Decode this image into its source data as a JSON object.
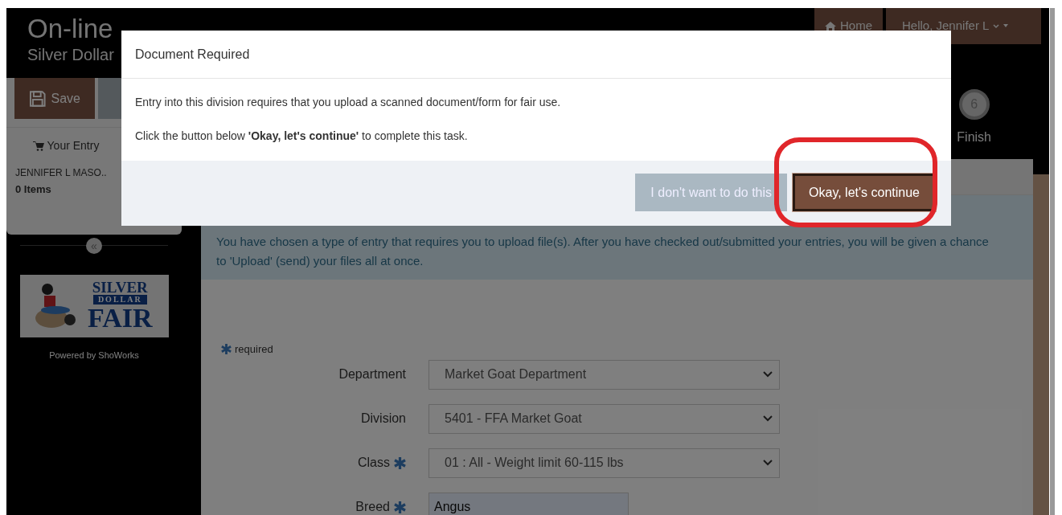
{
  "header": {
    "title": "On-line",
    "subtitle": "Silver Dollar"
  },
  "nav": [
    {
      "kind": "link",
      "label": "Home"
    },
    {
      "kind": "dropdown",
      "label": "Hello, Jennifer L"
    }
  ],
  "sidebar": {
    "save_button": "Save",
    "cart_label": "Your Entry",
    "entrant": "JENNIFER L MASO..",
    "items": "0 Items",
    "collapse": "«",
    "logo": [
      "SILVER",
      "DOLLAR",
      "FAIR"
    ],
    "powered_by": "Powered by ShoWorks"
  },
  "steps": [
    {
      "number": "6",
      "label": "Finish"
    }
  ],
  "alert": {
    "text": "You have chosen a type of entry that requires you to upload file(s). After you have checked out/submitted your entries, you will be given a chance to 'Upload' (send) your files all at once."
  },
  "form": {
    "required_note": "required",
    "fields": [
      {
        "label": "Department",
        "required": false,
        "kind": "select",
        "value": "Market Goat Department"
      },
      {
        "label": "Division",
        "required": false,
        "kind": "select",
        "value": "5401 - FFA Market Goat"
      },
      {
        "label": "Class",
        "required": true,
        "kind": "select",
        "value": "01 : All - Weight limit 60-115 lbs"
      },
      {
        "label": "Breed",
        "required": true,
        "kind": "text",
        "value": "Angus"
      }
    ]
  },
  "modal": {
    "title": "Document Required",
    "paragraphs": [
      "Entry into this division requires that you upload a scanned document/form for fair use.",
      "Click the button below **'Okay, let's continue'** to complete this task."
    ],
    "buttons": [
      {
        "kind": "secondary",
        "label": "I don't want to do this"
      },
      {
        "kind": "primary",
        "label": "Okay, let's continue"
      }
    ]
  }
}
